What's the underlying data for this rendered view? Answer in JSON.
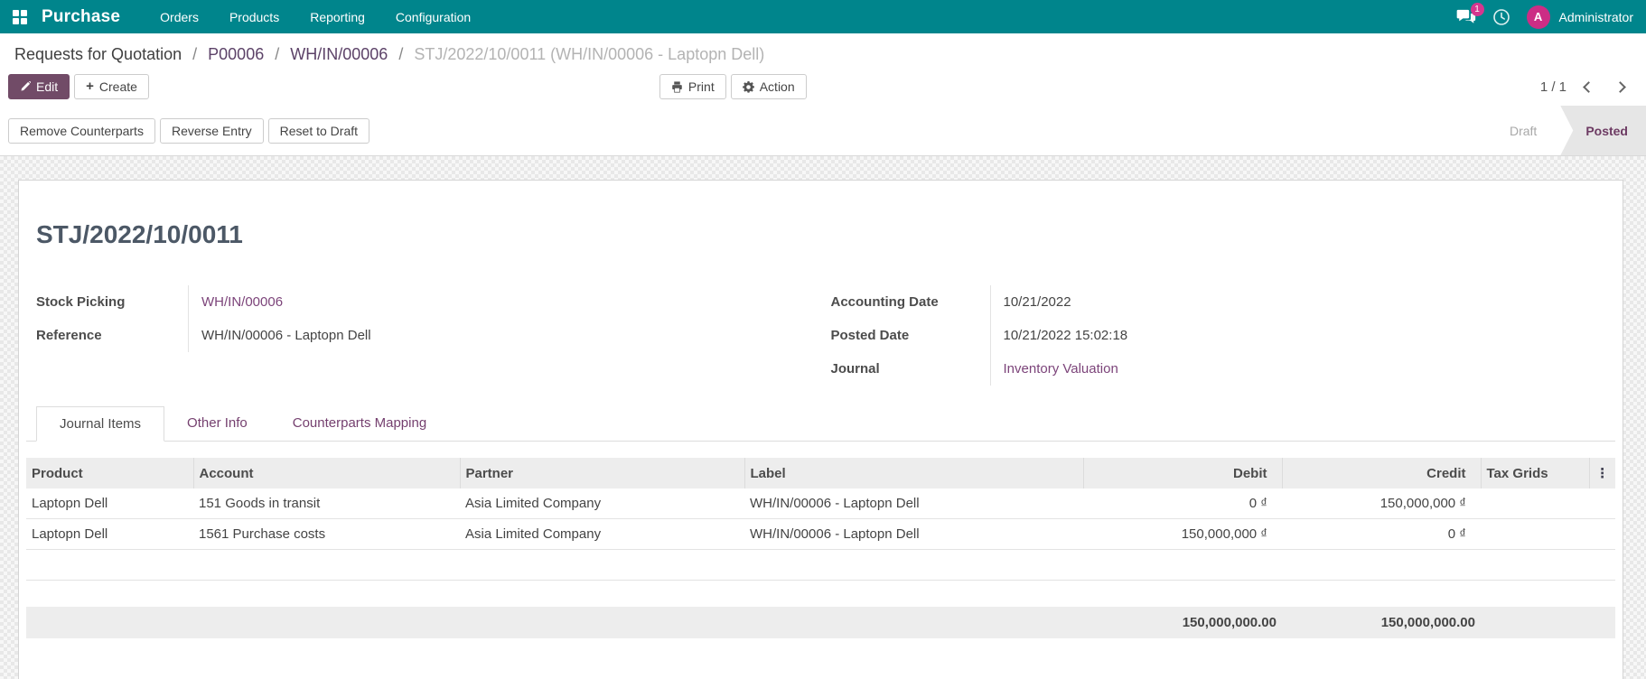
{
  "nav": {
    "app_name": "Purchase",
    "menus": [
      "Orders",
      "Products",
      "Reporting",
      "Configuration"
    ],
    "messages_badge": "1",
    "avatar_initial": "A",
    "user_name": "Administrator"
  },
  "breadcrumb": {
    "items": [
      {
        "label": "Requests for Quotation"
      },
      {
        "label": "P00006"
      },
      {
        "label": "WH/IN/00006"
      }
    ],
    "current": "STJ/2022/10/0011 (WH/IN/00006 - Laptopn Dell)",
    "separator": "/"
  },
  "control": {
    "edit_label": "Edit",
    "create_label": "Create",
    "print_label": "Print",
    "action_label": "Action",
    "pager": "1 / 1"
  },
  "statusbar": {
    "buttons": [
      "Remove Counterparts",
      "Reverse Entry",
      "Reset to Draft"
    ],
    "draft_label": "Draft",
    "posted_label": "Posted"
  },
  "form": {
    "title": "STJ/2022/10/0011",
    "fields_left": [
      {
        "label": "Stock Picking",
        "value": "WH/IN/00006"
      },
      {
        "label": "Reference",
        "value": "WH/IN/00006 - Laptopn Dell"
      }
    ],
    "fields_right": [
      {
        "label": "Accounting Date",
        "value": "10/21/2022"
      },
      {
        "label": "Posted Date",
        "value": "10/21/2022 15:02:18"
      },
      {
        "label": "Journal",
        "value": "Inventory Valuation"
      }
    ],
    "tabs": [
      {
        "label": "Journal Items"
      },
      {
        "label": "Other Info"
      },
      {
        "label": "Counterparts Mapping"
      }
    ]
  },
  "table": {
    "headers": [
      "Product",
      "Account",
      "Partner",
      "Label",
      "Debit",
      "Credit",
      "Tax Grids"
    ],
    "rows": [
      {
        "product": "Laptopn Dell",
        "account": "151 Goods in transit",
        "partner": "Asia Limited Company",
        "label": "WH/IN/00006 - Laptopn Dell",
        "debit": "0 ₫",
        "credit": "150,000,000 ₫"
      },
      {
        "product": "Laptopn Dell",
        "account": "1561 Purchase costs",
        "partner": "Asia Limited Company",
        "label": "WH/IN/00006 - Laptopn Dell",
        "debit": "150,000,000 ₫",
        "credit": "0 ₫"
      }
    ],
    "totals": {
      "debit": "150,000,000.00",
      "credit": "150,000,000.00"
    }
  },
  "colors": {
    "nav_teal": "#00858c",
    "accent_purple": "#714b67",
    "link_purple": "#7c447a",
    "magenta_badge": "#d6368f",
    "avatar_magenta": "#cc2d85",
    "title_slate": "#4c5866",
    "header_gray": "#ededed"
  }
}
